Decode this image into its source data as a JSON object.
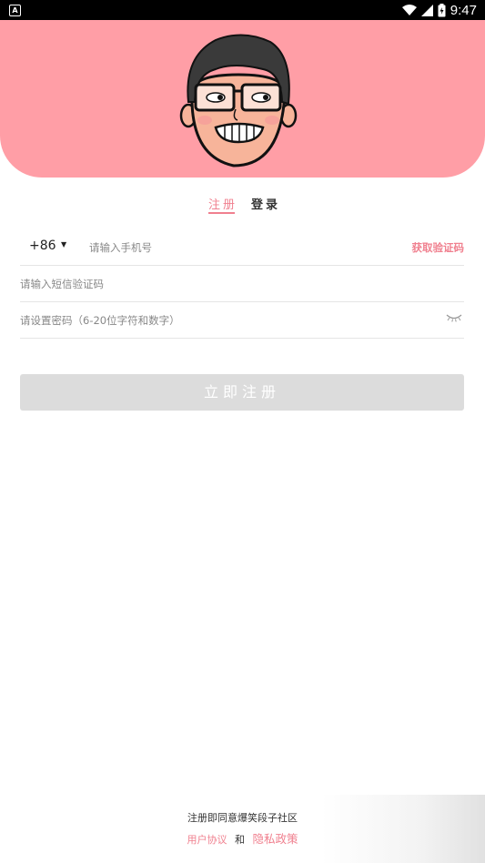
{
  "status_bar": {
    "time": "9:47",
    "app_icon": "A"
  },
  "tabs": {
    "register": "注册",
    "login": "登录"
  },
  "phone_row": {
    "country_code": "+86",
    "placeholder": "请输入手机号",
    "get_code": "获取验证码"
  },
  "sms_row": {
    "placeholder": "请输入短信验证码"
  },
  "password_row": {
    "placeholder": "请设置密码（6-20位字符和数字）"
  },
  "submit_button": {
    "label": "立即注册"
  },
  "terms": {
    "line1": "注册即同意爆笑段子社区",
    "user_agreement": "用户协议",
    "and": "和",
    "privacy_policy": "隐私政策"
  },
  "colors": {
    "header": "#ff9ea6",
    "accent": "#f0808f",
    "button_disabled": "#dcdcdc"
  }
}
